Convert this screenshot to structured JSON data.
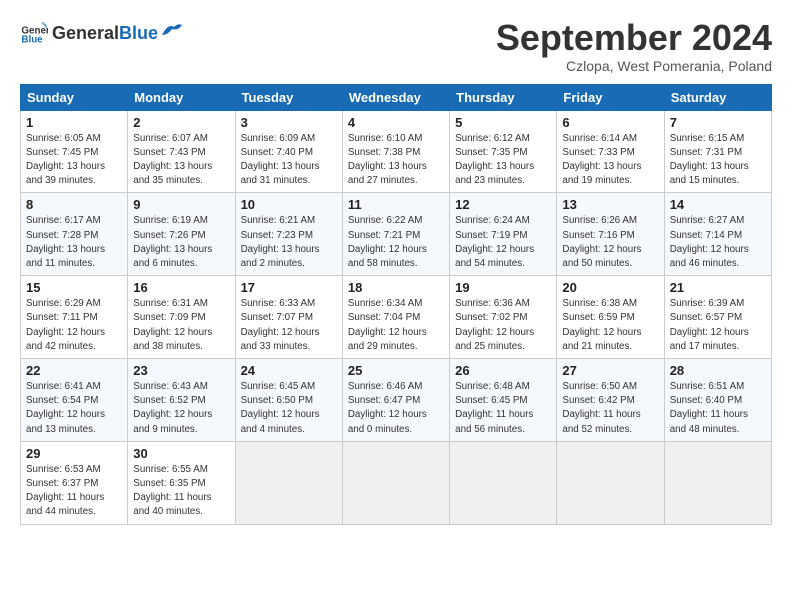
{
  "header": {
    "logo_general": "General",
    "logo_blue": "Blue",
    "title": "September 2024",
    "subtitle": "Czlopa, West Pomerania, Poland"
  },
  "columns": [
    "Sunday",
    "Monday",
    "Tuesday",
    "Wednesday",
    "Thursday",
    "Friday",
    "Saturday"
  ],
  "weeks": [
    [
      {
        "day": "1",
        "info": "Sunrise: 6:05 AM\nSunset: 7:45 PM\nDaylight: 13 hours\nand 39 minutes."
      },
      {
        "day": "2",
        "info": "Sunrise: 6:07 AM\nSunset: 7:43 PM\nDaylight: 13 hours\nand 35 minutes."
      },
      {
        "day": "3",
        "info": "Sunrise: 6:09 AM\nSunset: 7:40 PM\nDaylight: 13 hours\nand 31 minutes."
      },
      {
        "day": "4",
        "info": "Sunrise: 6:10 AM\nSunset: 7:38 PM\nDaylight: 13 hours\nand 27 minutes."
      },
      {
        "day": "5",
        "info": "Sunrise: 6:12 AM\nSunset: 7:35 PM\nDaylight: 13 hours\nand 23 minutes."
      },
      {
        "day": "6",
        "info": "Sunrise: 6:14 AM\nSunset: 7:33 PM\nDaylight: 13 hours\nand 19 minutes."
      },
      {
        "day": "7",
        "info": "Sunrise: 6:15 AM\nSunset: 7:31 PM\nDaylight: 13 hours\nand 15 minutes."
      }
    ],
    [
      {
        "day": "8",
        "info": "Sunrise: 6:17 AM\nSunset: 7:28 PM\nDaylight: 13 hours\nand 11 minutes."
      },
      {
        "day": "9",
        "info": "Sunrise: 6:19 AM\nSunset: 7:26 PM\nDaylight: 13 hours\nand 6 minutes."
      },
      {
        "day": "10",
        "info": "Sunrise: 6:21 AM\nSunset: 7:23 PM\nDaylight: 13 hours\nand 2 minutes."
      },
      {
        "day": "11",
        "info": "Sunrise: 6:22 AM\nSunset: 7:21 PM\nDaylight: 12 hours\nand 58 minutes."
      },
      {
        "day": "12",
        "info": "Sunrise: 6:24 AM\nSunset: 7:19 PM\nDaylight: 12 hours\nand 54 minutes."
      },
      {
        "day": "13",
        "info": "Sunrise: 6:26 AM\nSunset: 7:16 PM\nDaylight: 12 hours\nand 50 minutes."
      },
      {
        "day": "14",
        "info": "Sunrise: 6:27 AM\nSunset: 7:14 PM\nDaylight: 12 hours\nand 46 minutes."
      }
    ],
    [
      {
        "day": "15",
        "info": "Sunrise: 6:29 AM\nSunset: 7:11 PM\nDaylight: 12 hours\nand 42 minutes."
      },
      {
        "day": "16",
        "info": "Sunrise: 6:31 AM\nSunset: 7:09 PM\nDaylight: 12 hours\nand 38 minutes."
      },
      {
        "day": "17",
        "info": "Sunrise: 6:33 AM\nSunset: 7:07 PM\nDaylight: 12 hours\nand 33 minutes."
      },
      {
        "day": "18",
        "info": "Sunrise: 6:34 AM\nSunset: 7:04 PM\nDaylight: 12 hours\nand 29 minutes."
      },
      {
        "day": "19",
        "info": "Sunrise: 6:36 AM\nSunset: 7:02 PM\nDaylight: 12 hours\nand 25 minutes."
      },
      {
        "day": "20",
        "info": "Sunrise: 6:38 AM\nSunset: 6:59 PM\nDaylight: 12 hours\nand 21 minutes."
      },
      {
        "day": "21",
        "info": "Sunrise: 6:39 AM\nSunset: 6:57 PM\nDaylight: 12 hours\nand 17 minutes."
      }
    ],
    [
      {
        "day": "22",
        "info": "Sunrise: 6:41 AM\nSunset: 6:54 PM\nDaylight: 12 hours\nand 13 minutes."
      },
      {
        "day": "23",
        "info": "Sunrise: 6:43 AM\nSunset: 6:52 PM\nDaylight: 12 hours\nand 9 minutes."
      },
      {
        "day": "24",
        "info": "Sunrise: 6:45 AM\nSunset: 6:50 PM\nDaylight: 12 hours\nand 4 minutes."
      },
      {
        "day": "25",
        "info": "Sunrise: 6:46 AM\nSunset: 6:47 PM\nDaylight: 12 hours\nand 0 minutes."
      },
      {
        "day": "26",
        "info": "Sunrise: 6:48 AM\nSunset: 6:45 PM\nDaylight: 11 hours\nand 56 minutes."
      },
      {
        "day": "27",
        "info": "Sunrise: 6:50 AM\nSunset: 6:42 PM\nDaylight: 11 hours\nand 52 minutes."
      },
      {
        "day": "28",
        "info": "Sunrise: 6:51 AM\nSunset: 6:40 PM\nDaylight: 11 hours\nand 48 minutes."
      }
    ],
    [
      {
        "day": "29",
        "info": "Sunrise: 6:53 AM\nSunset: 6:37 PM\nDaylight: 11 hours\nand 44 minutes."
      },
      {
        "day": "30",
        "info": "Sunrise: 6:55 AM\nSunset: 6:35 PM\nDaylight: 11 hours\nand 40 minutes."
      },
      {
        "day": "",
        "info": ""
      },
      {
        "day": "",
        "info": ""
      },
      {
        "day": "",
        "info": ""
      },
      {
        "day": "",
        "info": ""
      },
      {
        "day": "",
        "info": ""
      }
    ]
  ]
}
